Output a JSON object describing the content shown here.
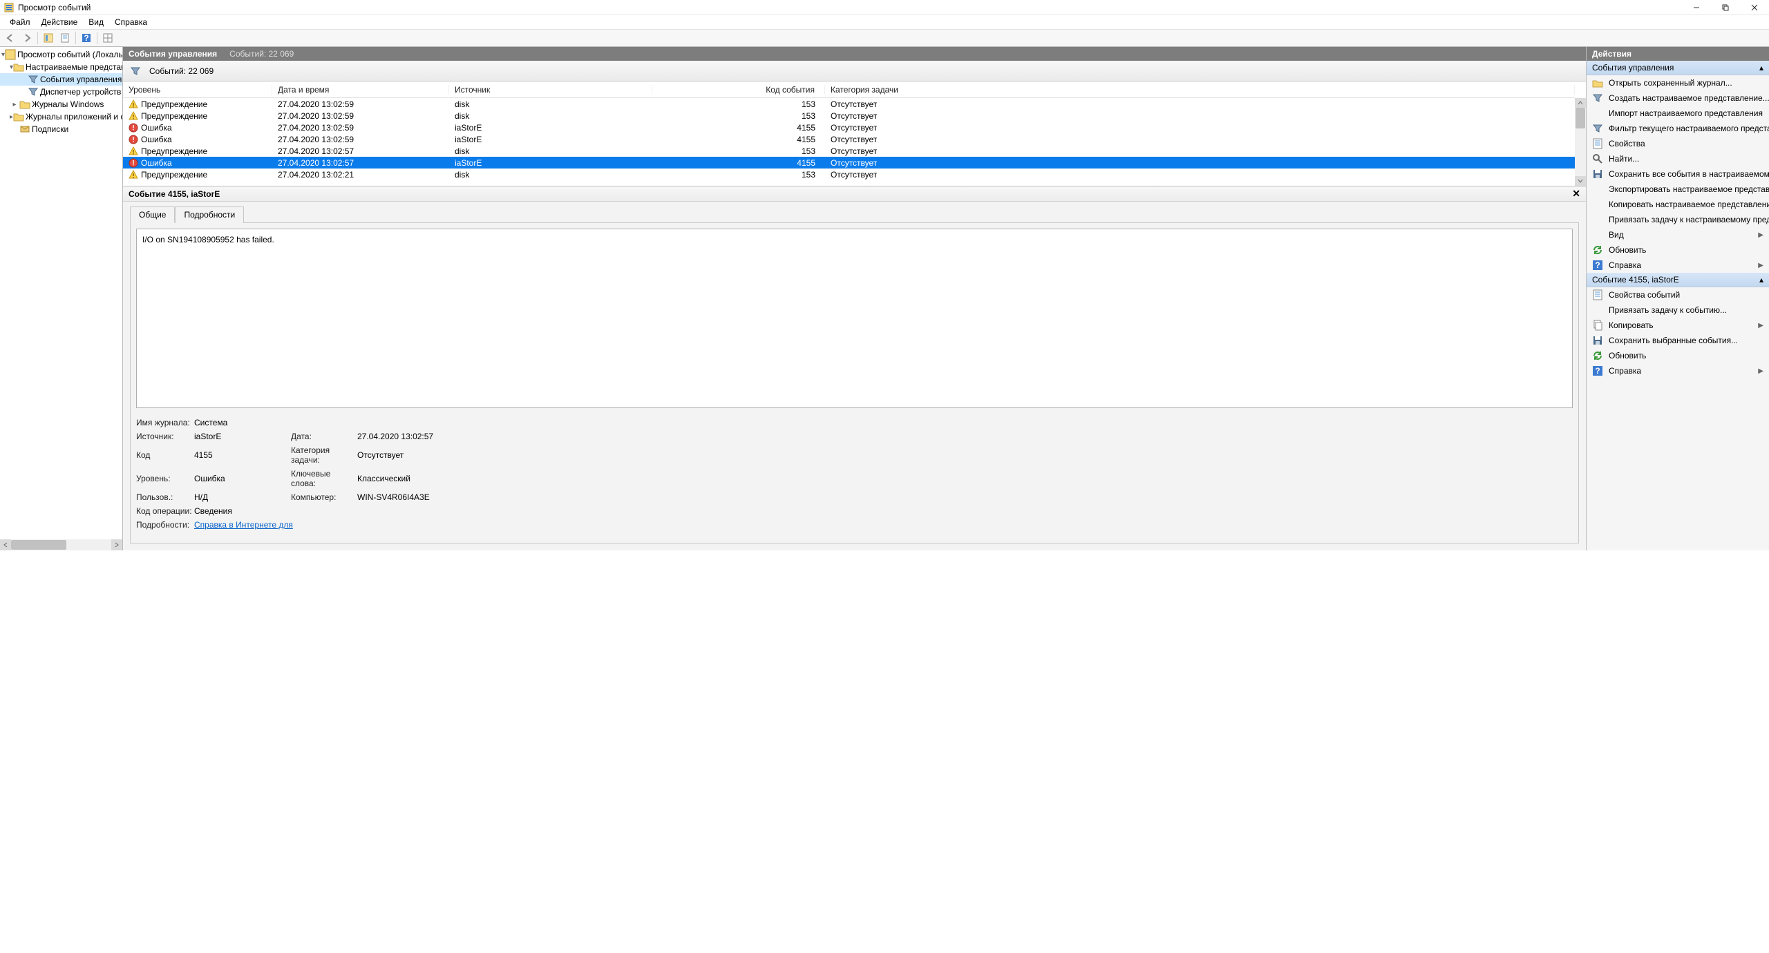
{
  "window": {
    "title": "Просмотр событий"
  },
  "menu": {
    "file": "Файл",
    "action": "Действие",
    "view": "Вид",
    "help": "Справка"
  },
  "tree": {
    "root": "Просмотр событий (Локальный)",
    "custom_views": "Настраиваемые представлен",
    "admin_events": "События управления",
    "device_mgr": "Диспетчер устройств - Р",
    "win_logs": "Журналы Windows",
    "app_logs": "Журналы приложений и слу",
    "subs": "Подписки"
  },
  "center": {
    "header_title": "События управления",
    "header_count": "Событий: 22 069",
    "filter_label": "Событий: 22 069",
    "columns": {
      "level": "Уровень",
      "date": "Дата и время",
      "source": "Источник",
      "id": "Код события",
      "category": "Категория задачи"
    },
    "rows": [
      {
        "level": "Предупреждение",
        "icon": "warn",
        "date": "27.04.2020 13:02:59",
        "source": "disk",
        "id": "153",
        "category": "Отсутствует",
        "selected": false
      },
      {
        "level": "Предупреждение",
        "icon": "warn",
        "date": "27.04.2020 13:02:59",
        "source": "disk",
        "id": "153",
        "category": "Отсутствует",
        "selected": false
      },
      {
        "level": "Ошибка",
        "icon": "error",
        "date": "27.04.2020 13:02:59",
        "source": "iaStorE",
        "id": "4155",
        "category": "Отсутствует",
        "selected": false
      },
      {
        "level": "Ошибка",
        "icon": "error",
        "date": "27.04.2020 13:02:59",
        "source": "iaStorE",
        "id": "4155",
        "category": "Отсутствует",
        "selected": false
      },
      {
        "level": "Предупреждение",
        "icon": "warn",
        "date": "27.04.2020 13:02:57",
        "source": "disk",
        "id": "153",
        "category": "Отсутствует",
        "selected": false
      },
      {
        "level": "Ошибка",
        "icon": "error",
        "date": "27.04.2020 13:02:57",
        "source": "iaStorE",
        "id": "4155",
        "category": "Отсутствует",
        "selected": true
      },
      {
        "level": "Предупреждение",
        "icon": "warn",
        "date": "27.04.2020 13:02:21",
        "source": "disk",
        "id": "153",
        "category": "Отсутствует",
        "selected": false
      }
    ]
  },
  "detail": {
    "title": "Событие 4155, iaStorE",
    "tab_general": "Общие",
    "tab_details": "Подробности",
    "message": "I/O on SN194108905952 has failed.",
    "labels": {
      "log_name": "Имя журнала:",
      "source": "Источник:",
      "code": "Код",
      "date": "Дата:",
      "task_cat": "Категория задачи:",
      "level": "Уровень:",
      "keywords": "Ключевые слова:",
      "user": "Пользов.:",
      "computer": "Компьютер:",
      "opcode": "Код операции:",
      "details": "Подробности:"
    },
    "values": {
      "log_name": "Система",
      "source": "iaStorE",
      "code": "4155",
      "date": "27.04.2020 13:02:57",
      "task_cat": "Отсутствует",
      "level": "Ошибка",
      "keywords": "Классический",
      "user": "Н/Д",
      "computer": "WIN-SV4R06I4A3E",
      "opcode": "Сведения",
      "details_link": "Справка в Интернете для "
    }
  },
  "actions": {
    "title": "Действия",
    "section1": "События управления",
    "items1": [
      {
        "label": "Открыть сохраненный журнал...",
        "icon": "open"
      },
      {
        "label": "Создать настраиваемое представление...",
        "icon": "filter"
      },
      {
        "label": "Импорт настраиваемого представления",
        "icon": "blank"
      },
      {
        "label": "Фильтр текущего настраиваемого представле...",
        "icon": "filter"
      },
      {
        "label": "Свойства",
        "icon": "props"
      },
      {
        "label": "Найти...",
        "icon": "find"
      },
      {
        "label": "Сохранить все события в настраиваемом пред...",
        "icon": "save"
      },
      {
        "label": "Экспортировать настраиваемое представлени...",
        "icon": "blank"
      },
      {
        "label": "Копировать настраиваемое представление...",
        "icon": "blank"
      },
      {
        "label": "Привязать задачу к настраиваемому представ...",
        "icon": "blank"
      },
      {
        "label": "Вид",
        "icon": "blank",
        "arrow": true
      },
      {
        "label": "Обновить",
        "icon": "refresh"
      },
      {
        "label": "Справка",
        "icon": "help",
        "arrow": true
      }
    ],
    "section2": "Событие 4155, iaStorE",
    "items2": [
      {
        "label": "Свойства событий",
        "icon": "props"
      },
      {
        "label": "Привязать задачу к событию...",
        "icon": "blank"
      },
      {
        "label": "Копировать",
        "icon": "copy",
        "arrow": true
      },
      {
        "label": "Сохранить выбранные события...",
        "icon": "save"
      },
      {
        "label": "Обновить",
        "icon": "refresh"
      },
      {
        "label": "Справка",
        "icon": "help",
        "arrow": true
      }
    ]
  }
}
